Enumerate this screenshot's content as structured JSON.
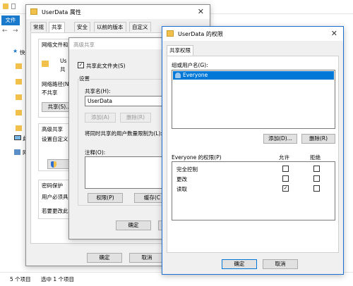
{
  "explorer": {
    "tab_label": "文件",
    "sidebar_fragments": [
      "快",
      "网",
      "此"
    ],
    "status_items": "5 个项目",
    "status_selected": "选中 1 个项目"
  },
  "properties": {
    "title": "UserData 属性",
    "tabs": [
      "常规",
      "共享",
      "安全",
      "以前的版本",
      "自定义"
    ],
    "net_share_heading": "网络文件和文",
    "folder_name": "Us",
    "folder_sub": "共",
    "net_path_label": "网络路径(N",
    "not_shared": "不共享",
    "share_button": "共享(S)...",
    "adv_share_heading": "高级共享",
    "adv_share_desc": "设置自定义",
    "adv_button_frag": "高",
    "password_heading": "密码保护",
    "password_desc1": "用户必须具有",
    "password_desc2": "若要更改此",
    "ok_button": "确定",
    "cancel_button": "取消"
  },
  "advanced_sharing": {
    "title": "高级共享",
    "share_folder_label": "共享此文件夹(S)",
    "share_folder_checked": true,
    "settings_label": "设置",
    "share_name_label": "共享名(H):",
    "share_name_value": "UserData",
    "add_button": "添加(A)",
    "remove_button": "删除(R)",
    "limit_label": "将同时共享的用户数量限制为(L):",
    "comment_label": "注释(O):",
    "permissions_button": "权限(P)",
    "caching_button": "缓存(C",
    "ok_button": "确定"
  },
  "permissions": {
    "title": "UserData 的权限",
    "tab_label": "共享权限",
    "group_label": "组或用户名(G):",
    "users": [
      "Everyone"
    ],
    "add_button": "添加(D)...",
    "remove_button": "删除(R)",
    "perm_header": "Everyone 的权限(P)",
    "allow_header": "允许",
    "deny_header": "拒绝",
    "rows": [
      {
        "name": "完全控制",
        "allow": false,
        "deny": false
      },
      {
        "name": "更改",
        "allow": false,
        "deny": false
      },
      {
        "name": "读取",
        "allow": true,
        "deny": false
      }
    ],
    "ok_button": "确定",
    "cancel_button": "取消"
  }
}
